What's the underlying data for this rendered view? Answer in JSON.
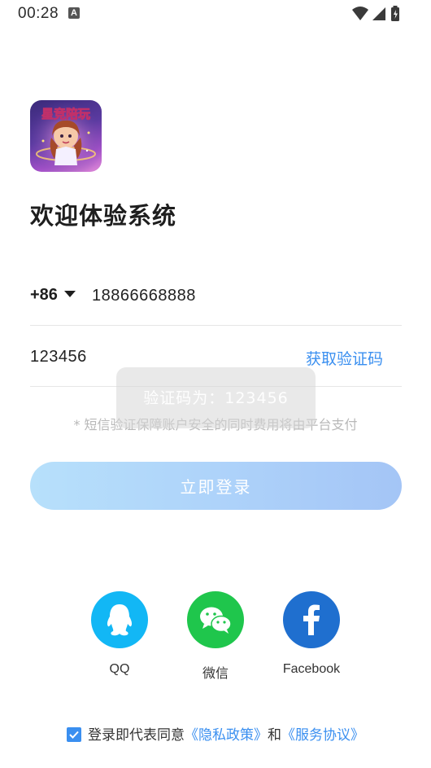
{
  "status_bar": {
    "time": "00:28",
    "notification_letter": "A"
  },
  "logo": {
    "text": "星竞陪玩"
  },
  "title": "欢迎体验系统",
  "phone": {
    "country_code": "+86",
    "value": "18866668888"
  },
  "code": {
    "value": "123456",
    "get_code_label": "获取验证码"
  },
  "hint": "* 短信验证保障账户安全的同时费用将由平台支付",
  "toast": "验证码为：123456",
  "login_button": "立即登录",
  "social": [
    {
      "label": "QQ",
      "icon": "qq-icon",
      "color": "#12b7f5"
    },
    {
      "label": "微信",
      "icon": "wechat-icon",
      "color": "#1fc64c"
    },
    {
      "label": "Facebook",
      "icon": "facebook-icon",
      "color": "#1f6fcf"
    }
  ],
  "agreement": {
    "prefix": "登录即代表同意",
    "privacy_link": "《隐私政策》",
    "and": "和",
    "service_link": "《服务协议》",
    "checked": true
  },
  "colors": {
    "accent": "#3a8ff0",
    "button_gradient_start": "#b7e0fb",
    "button_gradient_end": "#a4c5f6"
  }
}
